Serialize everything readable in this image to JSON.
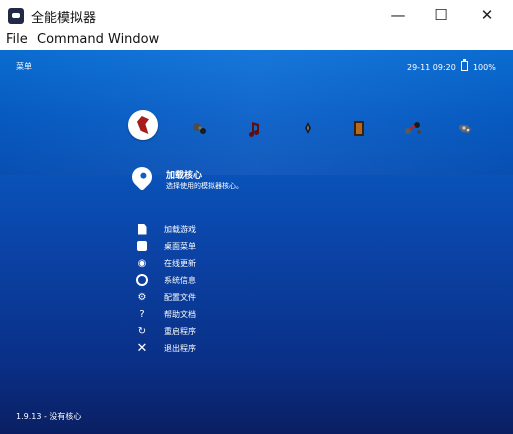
{
  "window": {
    "title": "全能模拟器",
    "controls": [
      "—",
      "☐",
      "✕"
    ]
  },
  "menu": [
    "File",
    "Command",
    "Window"
  ],
  "header": {
    "left": "菜单",
    "datetime": "29-11 09:20",
    "battery": "100%"
  },
  "categories": [
    {
      "name": "main-category-icon"
    },
    {
      "name": "settings-category-icon"
    },
    {
      "name": "music-category-icon"
    },
    {
      "name": "video-category-icon"
    },
    {
      "name": "book-category-icon"
    },
    {
      "name": "network-category-icon"
    },
    {
      "name": "controller-category-icon"
    }
  ],
  "core": {
    "title": "加载核心",
    "description": "选择使用的模拟器核心。"
  },
  "items": [
    {
      "label": "加载游戏",
      "icon": "document-icon"
    },
    {
      "label": "桌面菜单",
      "icon": "desktop-menu-icon"
    },
    {
      "label": "在线更新",
      "icon": "update-icon"
    },
    {
      "label": "系统信息",
      "icon": "info-icon"
    },
    {
      "label": "配置文件",
      "icon": "config-icon"
    },
    {
      "label": "帮助文档",
      "icon": "help-icon"
    },
    {
      "label": "重启程序",
      "icon": "restart-icon"
    },
    {
      "label": "退出程序",
      "icon": "close-icon"
    }
  ],
  "footer": {
    "version": "1.9.13 - 没有核心"
  }
}
